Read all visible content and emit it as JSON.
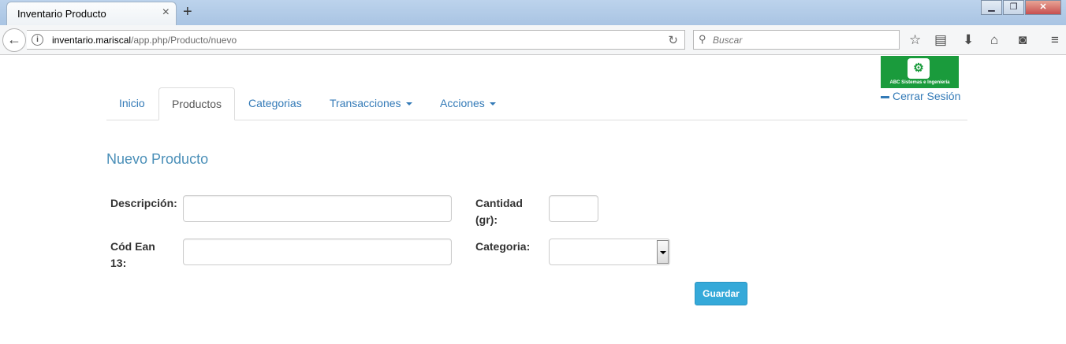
{
  "browser": {
    "tab_title": "Inventario Producto",
    "tab_close": "×",
    "new_tab": "+",
    "window_buttons": [
      "▁",
      "❐",
      "✕"
    ],
    "url_host": "inventario.mariscal",
    "url_path": "/app.php/Producto/nuevo",
    "search_placeholder": "Buscar",
    "icons": {
      "back": "back-arrow-icon",
      "info": "info-icon",
      "reload": "reload-icon",
      "search": "search-icon",
      "bookmark": "star-icon",
      "reading_list": "clipboard-icon",
      "downloads": "download-icon",
      "home": "home-icon",
      "pocket": "pocket-icon",
      "menu": "hamburger-menu-icon"
    }
  },
  "header": {
    "logo_text": "ABC Sistemas e Ingeniería",
    "logout_label": "Cerrar Sesión"
  },
  "nav": {
    "tabs": [
      {
        "label": "Inicio",
        "active": false,
        "dropdown": false
      },
      {
        "label": "Productos",
        "active": true,
        "dropdown": false
      },
      {
        "label": "Categorias",
        "active": false,
        "dropdown": false
      },
      {
        "label": "Transacciones",
        "active": false,
        "dropdown": true
      },
      {
        "label": "Acciones",
        "active": false,
        "dropdown": true
      }
    ]
  },
  "form": {
    "title": "Nuevo Producto",
    "descripcion_label": "Descripción:",
    "descripcion_value": "",
    "ean_label": "Cód Ean 13:",
    "ean_value": "",
    "cantidad_label": "Cantidad (gr):",
    "cantidad_value": "",
    "categoria_label": "Categoria:",
    "categoria_value": "",
    "save_label": "Guardar"
  },
  "colors": {
    "link": "#337ab7",
    "title": "#4a8fb8",
    "button": "#35a9d9",
    "logo_bg": "#1a9b3c"
  }
}
